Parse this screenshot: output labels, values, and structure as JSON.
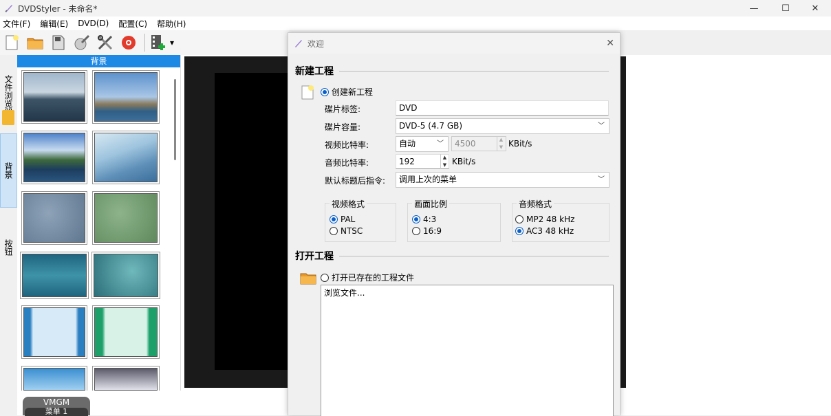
{
  "window": {
    "title": "DVDStyler - 未命名*",
    "minimize": "—",
    "maximize": "☐",
    "close": "✕"
  },
  "menu": [
    "文件(F)",
    "编辑(E)",
    "DVD(D)",
    "配置(C)",
    "帮助(H)"
  ],
  "toolbar": {
    "dropdown": "▾"
  },
  "side_tabs": {
    "file_browser": "文件浏览器",
    "background": "背景",
    "buttons": "按钮"
  },
  "panel": {
    "header": "背景"
  },
  "bottom": {
    "title_set": "VMGM",
    "menu_item": "菜单 1"
  },
  "dialog": {
    "title": "欢迎",
    "close": "✕",
    "new_project": {
      "heading": "新建工程",
      "create_option": "创建新工程",
      "disc_label_label": "碟片标签:",
      "disc_label_value": "DVD",
      "disc_capacity_label": "碟片容量:",
      "disc_capacity_value": "DVD-5 (4.7 GB)",
      "video_bitrate_label": "视频比特率:",
      "video_bitrate_mode": "自动",
      "video_bitrate_value": "4500",
      "video_bitrate_unit": "KBit/s",
      "audio_bitrate_label": "音频比特率:",
      "audio_bitrate_value": "192",
      "audio_bitrate_unit": "KBit/s",
      "default_post_label": "默认标题后指令:",
      "default_post_value": "调用上次的菜单",
      "video_format": {
        "title": "视频格式",
        "options": [
          "PAL",
          "NTSC"
        ],
        "selected": "PAL"
      },
      "aspect_ratio": {
        "title": "画面比例",
        "options": [
          "4:3",
          "16:9"
        ],
        "selected": "4:3"
      },
      "audio_format": {
        "title": "音频格式",
        "options": [
          "MP2 48 kHz",
          "AC3 48 kHz"
        ],
        "selected": "AC3 48 kHz"
      }
    },
    "open_project": {
      "heading": "打开工程",
      "open_option": "打开已存在的工程文件",
      "browse_item": "浏览文件..."
    }
  }
}
